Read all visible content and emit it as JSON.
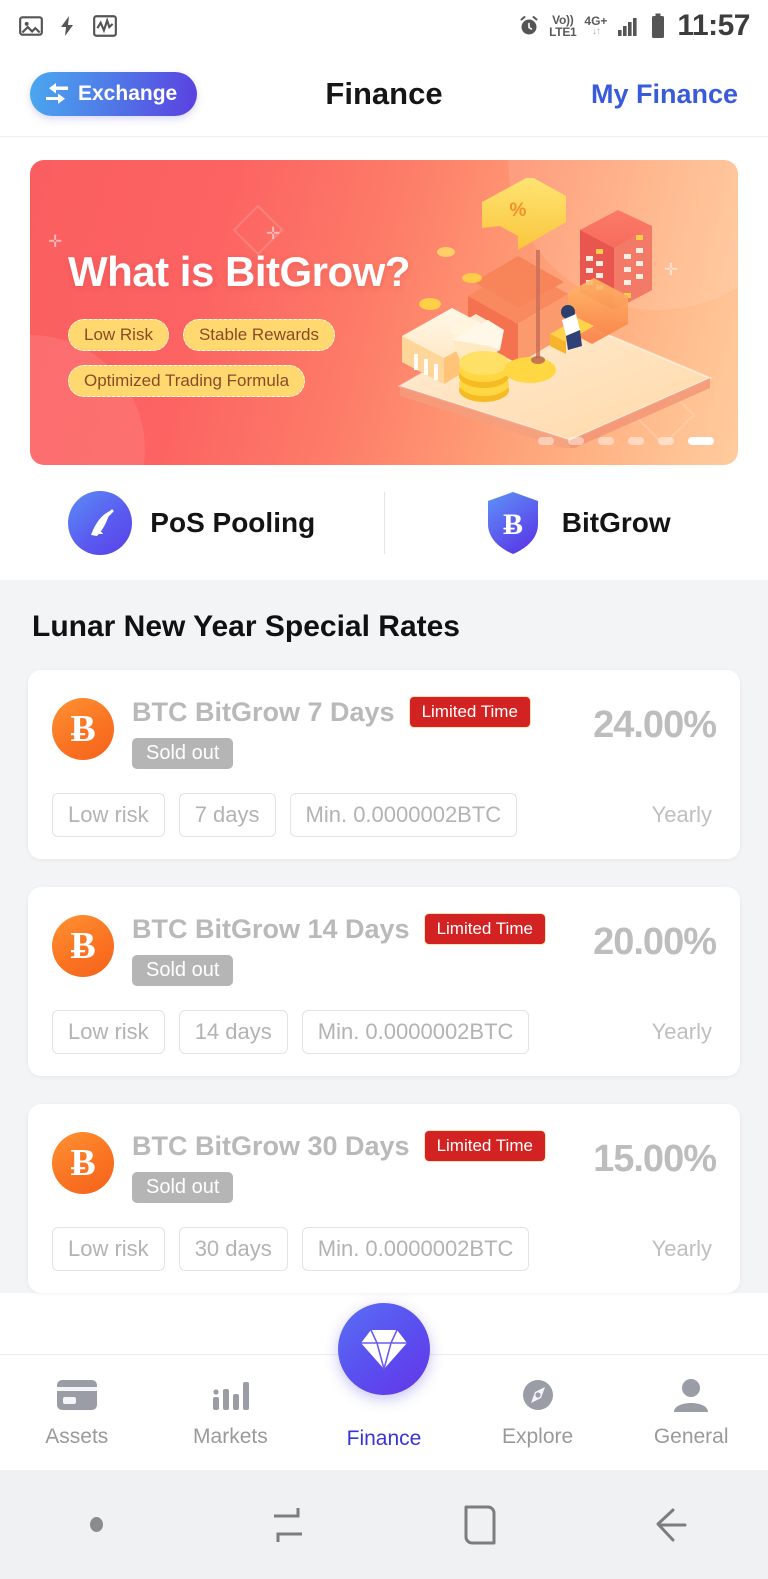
{
  "status_bar": {
    "icons": [
      "image-icon",
      "flash-icon",
      "activity-icon"
    ],
    "alarm_icon": "alarm-clock-icon",
    "volte_line1": "Vo))",
    "volte_line2": "LTE1",
    "network_type": "4G+",
    "data_arrows": "↓↑",
    "signal_icon": "signal-bars-icon",
    "battery_icon": "battery-icon",
    "time": "11:57"
  },
  "header": {
    "exchange_label": "Exchange",
    "exchange_icon": "swap-arrows-icon",
    "title": "Finance",
    "my_finance_label": "My Finance"
  },
  "banner": {
    "title": "What is BitGrow?",
    "pills_row1": [
      "Low Risk",
      "Stable Rewards"
    ],
    "pills_row2": [
      "Optimized Trading Formula"
    ],
    "dots_total": 6,
    "dots_active_index": 5,
    "gradient_start": "#fb5e60",
    "gradient_end": "#ffcb9e",
    "pill_bg": "#ffd970",
    "pill_text_color": "#8a4a2a"
  },
  "categories": [
    {
      "label": "PoS Pooling",
      "icon": "pickaxe-icon"
    },
    {
      "label": "BitGrow",
      "icon": "bitcoin-shield-icon"
    }
  ],
  "section": {
    "title": "Lunar New Year Special Rates"
  },
  "products": [
    {
      "coin_icon": "bitcoin-icon",
      "coin_symbol": "Ƀ",
      "name": "BTC BitGrow 7 Days",
      "limited_badge": "Limited Time",
      "sold_out_badge": "Sold out",
      "rate": "24.00%",
      "period_label": "Yearly",
      "tags": [
        "Low risk",
        "7 days",
        "Min. 0.0000002BTC"
      ]
    },
    {
      "coin_icon": "bitcoin-icon",
      "coin_symbol": "Ƀ",
      "name": "BTC BitGrow 14 Days",
      "limited_badge": "Limited Time",
      "sold_out_badge": "Sold out",
      "rate": "20.00%",
      "period_label": "Yearly",
      "tags": [
        "Low risk",
        "14 days",
        "Min. 0.0000002BTC"
      ]
    },
    {
      "coin_icon": "bitcoin-icon",
      "coin_symbol": "Ƀ",
      "name": "BTC BitGrow 30 Days",
      "limited_badge": "Limited Time",
      "sold_out_badge": "Sold out",
      "rate": "15.00%",
      "period_label": "Yearly",
      "tags": [
        "Low risk",
        "30 days",
        "Min. 0.0000002BTC"
      ]
    }
  ],
  "tabbar": {
    "items": [
      {
        "label": "Assets",
        "icon": "wallet-card-icon",
        "active": false
      },
      {
        "label": "Markets",
        "icon": "bar-chart-icon",
        "active": false
      },
      {
        "label": "Finance",
        "icon": "diamond-icon",
        "active": true
      },
      {
        "label": "Explore",
        "icon": "compass-icon",
        "active": false
      },
      {
        "label": "General",
        "icon": "person-icon",
        "active": false
      }
    ],
    "active_color": "#3a34d6",
    "inactive_color": "#9a9a9a"
  },
  "android_nav": {
    "items": [
      "dot-indicator",
      "recents-icon",
      "home-icon",
      "back-icon"
    ]
  },
  "colors": {
    "accent_blue": "#3a5bd9",
    "badge_red": "#d32222",
    "bitcoin_orange": "#fa7422",
    "page_bg": "#f3f4f6"
  }
}
